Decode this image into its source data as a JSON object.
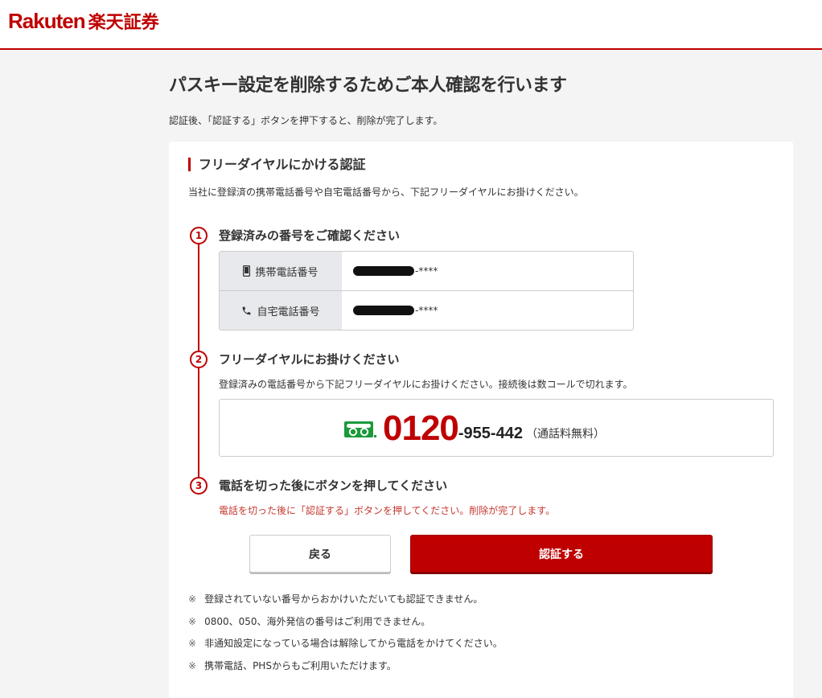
{
  "header": {
    "logo_en": "Rakuten",
    "logo_ja": "楽天証券",
    "brand_color": "#bf0000"
  },
  "page": {
    "title": "パスキー設定を削除するためご本人確認を行います",
    "subtitle": "認証後、「認証する」ボタンを押下すると、削除が完了します。"
  },
  "section": {
    "title": "フリーダイヤルにかける認証",
    "description": "当社に登録済の携帯電話番号や自宅電話番号から、下記フリーダイヤルにお掛けください。"
  },
  "steps": [
    {
      "number": "1",
      "title": "登録済みの番号をご確認ください"
    },
    {
      "number": "2",
      "title": "フリーダイヤルにお掛けください",
      "description": "登録済みの電話番号から下記フリーダイヤルにお掛けください。接続後は数コールで切れます。"
    },
    {
      "number": "3",
      "title": "電話を切った後にボタンを押してください",
      "description": "電話を切った後に「認証する」ボタンを押してください。削除が完了します。"
    }
  ],
  "phones": [
    {
      "label": "携帯電話番号",
      "icon": "smartphone-icon",
      "value_suffix": "-****"
    },
    {
      "label": "自宅電話番号",
      "icon": "phone-icon",
      "value_suffix": "-****"
    }
  ],
  "free_dial": {
    "icon": "free-dial-icon",
    "main": "0120",
    "rest": "-955-442",
    "note": "（通話料無料）"
  },
  "buttons": {
    "back": "戻る",
    "authenticate": "認証する"
  },
  "notes": [
    {
      "mark": "※",
      "text": "登録されていない番号からおかけいただいても認証できません。"
    },
    {
      "mark": "※",
      "text": "0800、050、海外発信の番号はご利用できません。"
    },
    {
      "mark": "※",
      "text": "非通知設定になっている場合は解除してから電話をかけてください。"
    },
    {
      "mark": "※",
      "text": "携帯電話、PHSからもご利用いただけます。"
    }
  ]
}
